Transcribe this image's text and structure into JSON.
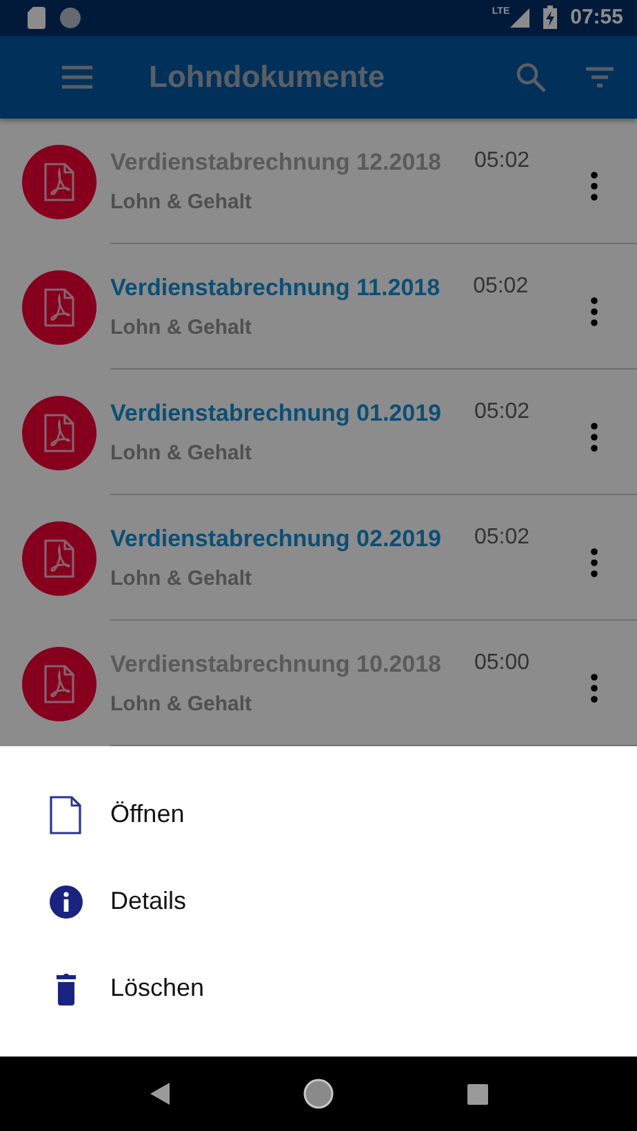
{
  "status_bar": {
    "network": "LTE",
    "time": "07:55"
  },
  "toolbar": {
    "title": "Lohndokumente"
  },
  "documents": [
    {
      "title": "Verdienstabrechnung 12.2018",
      "time": "05:02",
      "category": "Lohn & Gehalt",
      "unread": false
    },
    {
      "title": "Verdienstabrechnung 11.2018",
      "time": "05:02",
      "category": "Lohn & Gehalt",
      "unread": true
    },
    {
      "title": "Verdienstabrechnung 01.2019",
      "time": "05:02",
      "category": "Lohn & Gehalt",
      "unread": true
    },
    {
      "title": "Verdienstabrechnung 02.2019",
      "time": "05:02",
      "category": "Lohn & Gehalt",
      "unread": true
    },
    {
      "title": "Verdienstabrechnung 10.2018",
      "time": "05:00",
      "category": "Lohn & Gehalt",
      "unread": false
    }
  ],
  "bottom_sheet": {
    "open": true,
    "actions": [
      {
        "kind": "open",
        "label": "Öffnen"
      },
      {
        "kind": "details",
        "label": "Details"
      },
      {
        "kind": "delete",
        "label": "Löschen"
      }
    ]
  }
}
